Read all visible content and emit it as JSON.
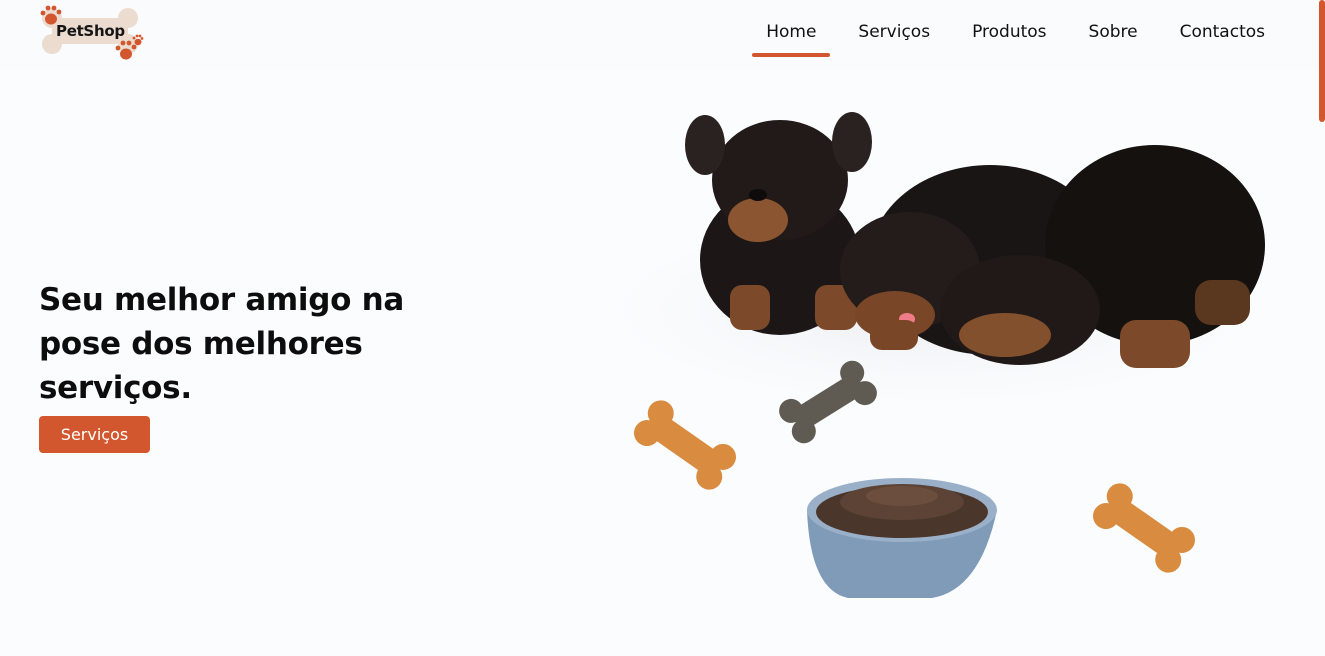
{
  "brand": {
    "name": "PetShop",
    "accent": "#d2572f",
    "bone_color": "#ecdcd0"
  },
  "nav": {
    "items": [
      {
        "label": "Home",
        "active": true
      },
      {
        "label": "Serviços",
        "active": false
      },
      {
        "label": "Produtos",
        "active": false
      },
      {
        "label": "Sobre",
        "active": false
      },
      {
        "label": "Contactos",
        "active": false
      }
    ]
  },
  "hero": {
    "title": "Seu melhor amigo na pose dos melhores serviços.",
    "button_label": "Serviços",
    "image": "puppies-eating-with-bones-and-food-bowl"
  }
}
